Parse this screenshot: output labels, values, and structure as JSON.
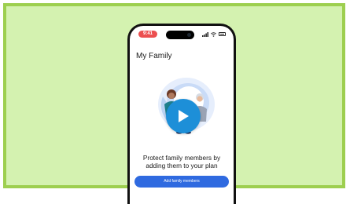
{
  "status_bar": {
    "time": "9:41",
    "signal_icon": "signal-icon",
    "wifi_icon": "wifi-icon",
    "battery_icon": "battery-icon"
  },
  "screen": {
    "title": "My Family",
    "headline_line1": "Protect family members by",
    "headline_line2": "adding them to your plan",
    "add_button_label": "Add family members"
  },
  "video": {
    "play_icon": "play-icon"
  },
  "colors": {
    "frame_border": "#9dcf4f",
    "frame_background": "#d4f2b0",
    "play_button": "#1d8fd8",
    "primary_button": "#2f6ae0",
    "status_pill": "#ec4f50"
  }
}
